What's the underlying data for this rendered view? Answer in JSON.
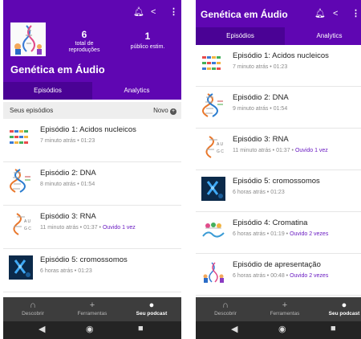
{
  "show_title": "Genética em Áudio",
  "header_icons": [
    "bell-icon",
    "share-icon",
    "more-vert-icon"
  ],
  "stats": {
    "plays_value": "6",
    "plays_label": "total de reproduções",
    "audience_value": "1",
    "audience_label": "público estim."
  },
  "tabs": {
    "episodes": "Episódios",
    "analytics": "Analytics"
  },
  "section": {
    "label": "Seus episódios",
    "new_label": "Novo"
  },
  "left_episodes": [
    {
      "title": "Episódio 1: Acidos nucleicos",
      "time_ago": "7 minuto atrás",
      "duration": "01:23",
      "heard": ""
    },
    {
      "title": "Episódio 2: DNA",
      "time_ago": "8 minuto atrás",
      "duration": "01:54",
      "heard": ""
    },
    {
      "title": "Episódio 3: RNA",
      "time_ago": "11 minuto atrás",
      "duration": "01:37",
      "heard": "Ouvido 1 vez"
    },
    {
      "title": "Episódio 5: cromossomos",
      "time_ago": "6 horas atrás",
      "duration": "01:23",
      "heard": ""
    }
  ],
  "right_episodes": [
    {
      "title": "Episódio 1: Acidos nucleicos",
      "time_ago": "7 minuto atrás",
      "duration": "01:23",
      "heard": ""
    },
    {
      "title": "Episódio 2: DNA",
      "time_ago": "9 minuto atrás",
      "duration": "01:54",
      "heard": ""
    },
    {
      "title": "Episódio 3: RNA",
      "time_ago": "11 minuto atrás",
      "duration": "01:37",
      "heard": "Ouvido 1 vez"
    },
    {
      "title": "Episódio 5: cromossomos",
      "time_ago": "6 horas atrás",
      "duration": "01:23",
      "heard": ""
    },
    {
      "title": "Episódio 4: Cromatina",
      "time_ago": "6 horas atrás",
      "duration": "01:19",
      "heard": "Ouvido 2 vezes"
    },
    {
      "title": "Episódio de apresentação",
      "time_ago": "6 horas atrás",
      "duration": "00:48",
      "heard": "Ouvido 2 vezes"
    }
  ],
  "bottom_nav": [
    {
      "label": "Descobrir",
      "icon": "headphones-icon"
    },
    {
      "label": "Ferramentas",
      "icon": "plus-icon"
    },
    {
      "label": "Seu podcast",
      "icon": "person-icon"
    }
  ],
  "system_nav": [
    "back-icon",
    "home-icon",
    "recents-icon"
  ],
  "colors": {
    "brand": "#5f06b2",
    "tab_active": "#4a0295",
    "heard": "#6a1bc2",
    "nav_bg": "#3d3d3d"
  }
}
